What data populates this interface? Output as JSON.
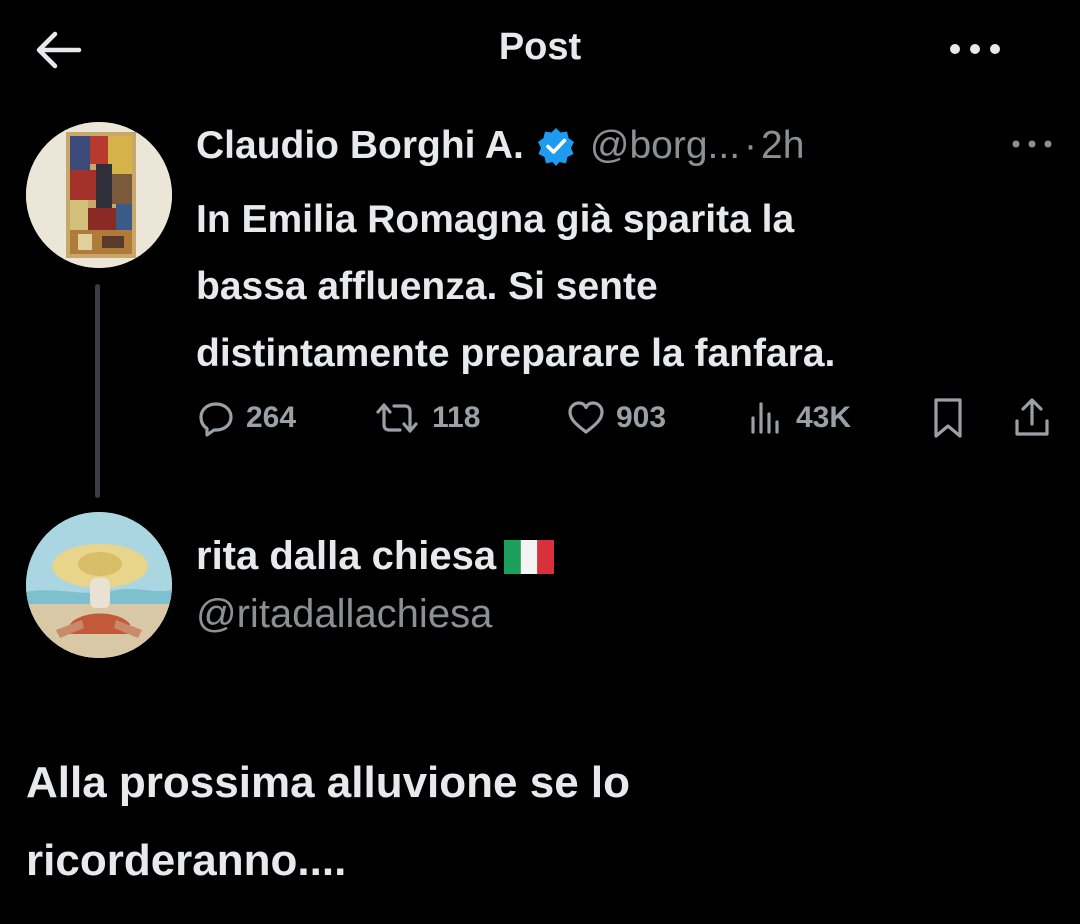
{
  "header": {
    "title": "Post",
    "back_icon": "arrow-left-icon",
    "more_icon": "ellipsis-icon"
  },
  "tweet": {
    "author_name": "Claudio Borghi A.",
    "verified": true,
    "handle": "@borg...",
    "dot": "·",
    "time": "2h",
    "text_lines": [
      "In Emilia Romagna già sparita la",
      "bassa affluenza. Si sente",
      "distintamente preparare la fanfara."
    ],
    "actions": {
      "replies": "264",
      "retweets": "118",
      "likes": "903",
      "views": "43K"
    }
  },
  "reply": {
    "author_name": "rita dalla chiesa",
    "flag": "italy-flag-icon",
    "handle": "@ritadallachiesa",
    "text_lines": [
      "Alla prossima alluvione se lo",
      "ricorderanno...."
    ]
  },
  "colors": {
    "background": "#000000",
    "text": "#e7e9ea",
    "secondary": "#8b9095",
    "verified_blue": "#1d9bf0"
  }
}
